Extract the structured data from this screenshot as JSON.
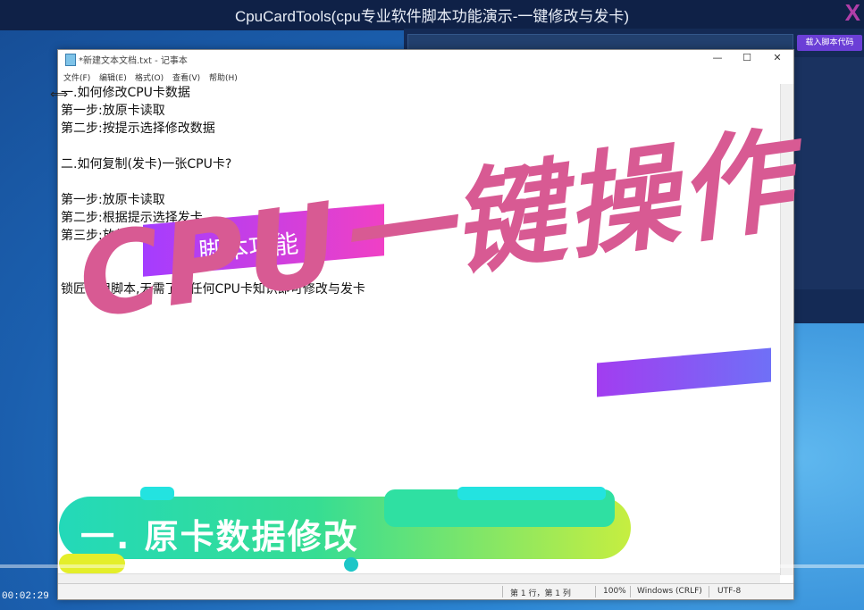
{
  "window": {
    "title": "CpuCardTools(cpu专业软件脚本功能演示-一键修改与发卡)",
    "close_label": "X"
  },
  "right_panel": {
    "load_script_button": "载入脚本代码"
  },
  "notepad": {
    "title": "*新建文本文档.txt - 记事本",
    "controls": {
      "minimize": "—",
      "maximize": "☐",
      "close": "✕"
    },
    "menu": [
      "文件(F)",
      "编辑(E)",
      "格式(O)",
      "查看(V)",
      "帮助(H)"
    ],
    "lines": [
      "一.如何修改CPU卡数据",
      "第一步:放原卡读取",
      "第二步:按提示选择修改数据",
      "",
      "二.如何复制(发卡)一张CPU卡?",
      "",
      "第一步:放原卡读取",
      "第二步:根据提示选择发卡",
      "第三步:放新卡写",
      "",
      "",
      "锁匠专用脚本,无需了解任何CPU卡知识即可修改与发卡"
    ],
    "status": {
      "position": "第 1 行，第 1 列",
      "zoom": "100%",
      "line_ending": "Windows (CRLF)",
      "encoding": "UTF-8"
    }
  },
  "overlay": {
    "badge_text": "脚本功能",
    "headline": "CPU一键操作",
    "banner_text": "一. 原卡数据修改"
  },
  "video": {
    "timecode": "00:02:29"
  },
  "colors": {
    "headline": "#d85a93",
    "badge_gradient_start": "#a43dff",
    "badge_gradient_end": "#f040c5",
    "banner_start": "#23d9b9",
    "banner_end": "#c6ee40"
  }
}
